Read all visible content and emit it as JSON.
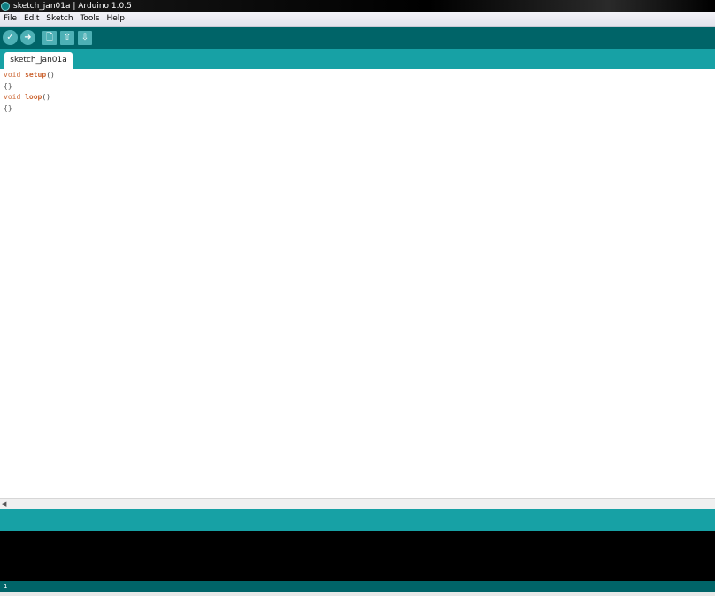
{
  "window": {
    "title": "sketch_jan01a | Arduino 1.0.5"
  },
  "menu": {
    "items": [
      "File",
      "Edit",
      "Sketch",
      "Tools",
      "Help"
    ]
  },
  "toolbar": {
    "buttons": [
      {
        "name": "verify",
        "glyph": "✓"
      },
      {
        "name": "upload",
        "glyph": "➜"
      },
      {
        "name": "new",
        "glyph": "🗋"
      },
      {
        "name": "open",
        "glyph": "⇧"
      },
      {
        "name": "save",
        "glyph": "⇩"
      }
    ]
  },
  "tabs": [
    {
      "label": "sketch_jan01a"
    }
  ],
  "editor": {
    "lines": [
      {
        "keyword": "void",
        "function": "setup",
        "paren": "()"
      },
      {
        "text": "{}"
      },
      {
        "keyword": "void",
        "function": "loop",
        "paren": "()"
      },
      {
        "text": "{}"
      }
    ]
  },
  "footer": {
    "line_number": "1"
  },
  "colors": {
    "toolbar_dark": "#006468",
    "tab_teal": "#17a1a5",
    "button_teal": "#4db0b5",
    "keyword_orange": "#cc6633"
  }
}
